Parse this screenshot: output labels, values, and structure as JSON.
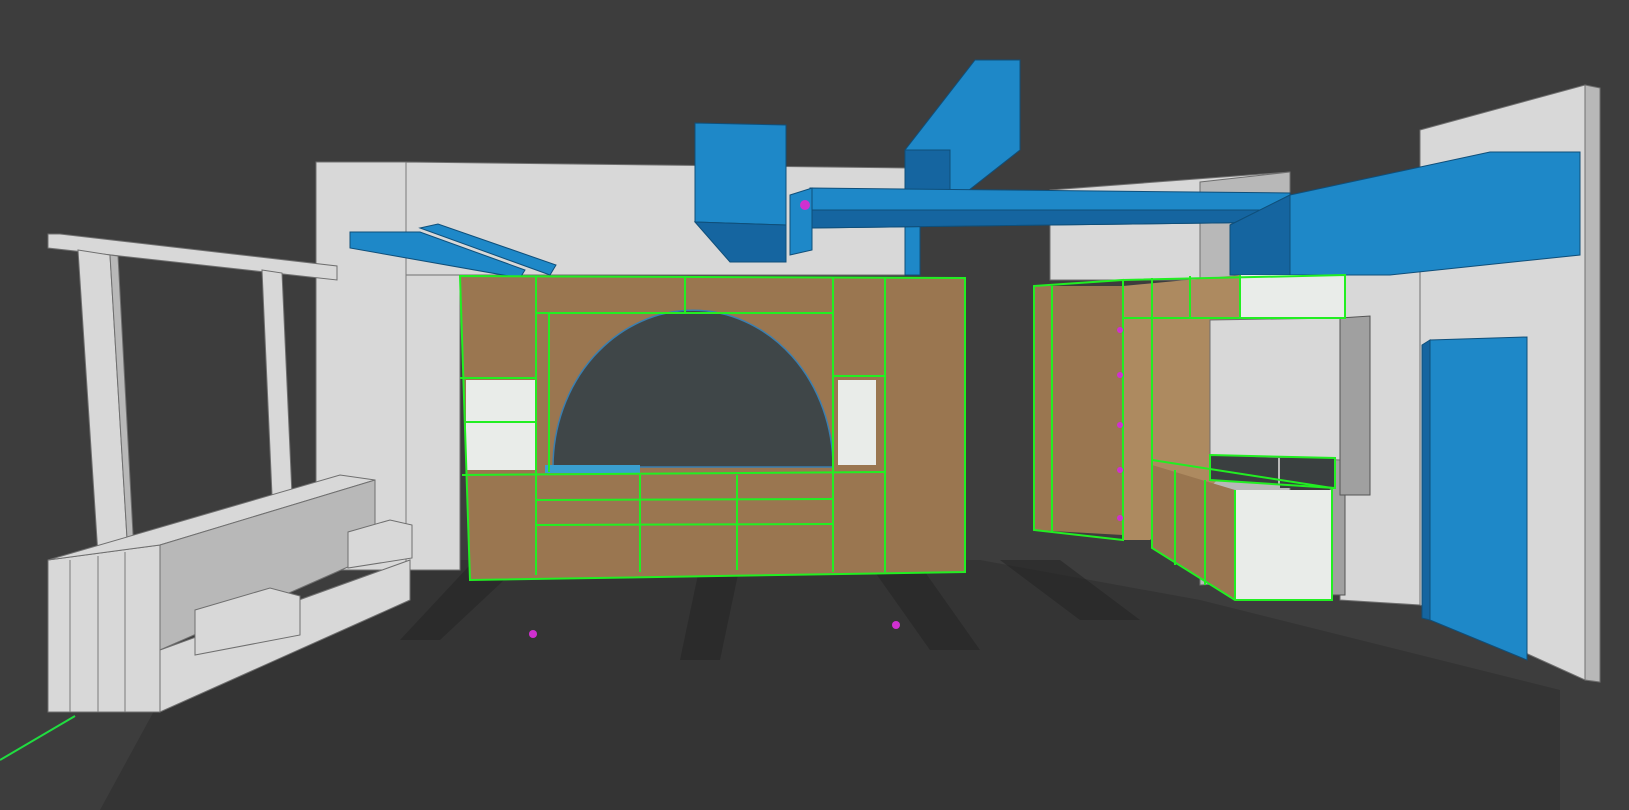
{
  "viewport": {
    "mode": "3d-model-view",
    "background_color": "#3d3d3d",
    "floor_shadow_color": "#2e2e2e"
  },
  "colors": {
    "wall": "#d8d8d8",
    "wall_shade": "#b8b8b8",
    "wall_dark": "#a0a0a0",
    "duct_blue": "#1e88c8",
    "duct_blue_dark": "#1565a0",
    "wood": "#9a7650",
    "wood_light": "#ad8a60",
    "selection_outline": "#22ee22",
    "arch_void": "#3f4648",
    "component_marker": "#d030d0",
    "axis_green": "#20dd40"
  },
  "scene": {
    "objects": [
      {
        "name": "back-wall",
        "selected": false
      },
      {
        "name": "right-wall",
        "selected": false
      },
      {
        "name": "left-pergola-bench",
        "selected": false
      },
      {
        "name": "hvac-ductwork",
        "selected": false
      },
      {
        "name": "arch-cabinet-wall",
        "selected": true
      },
      {
        "name": "corner-cabinet-group",
        "selected": true
      },
      {
        "name": "blue-door",
        "selected": false
      }
    ]
  }
}
